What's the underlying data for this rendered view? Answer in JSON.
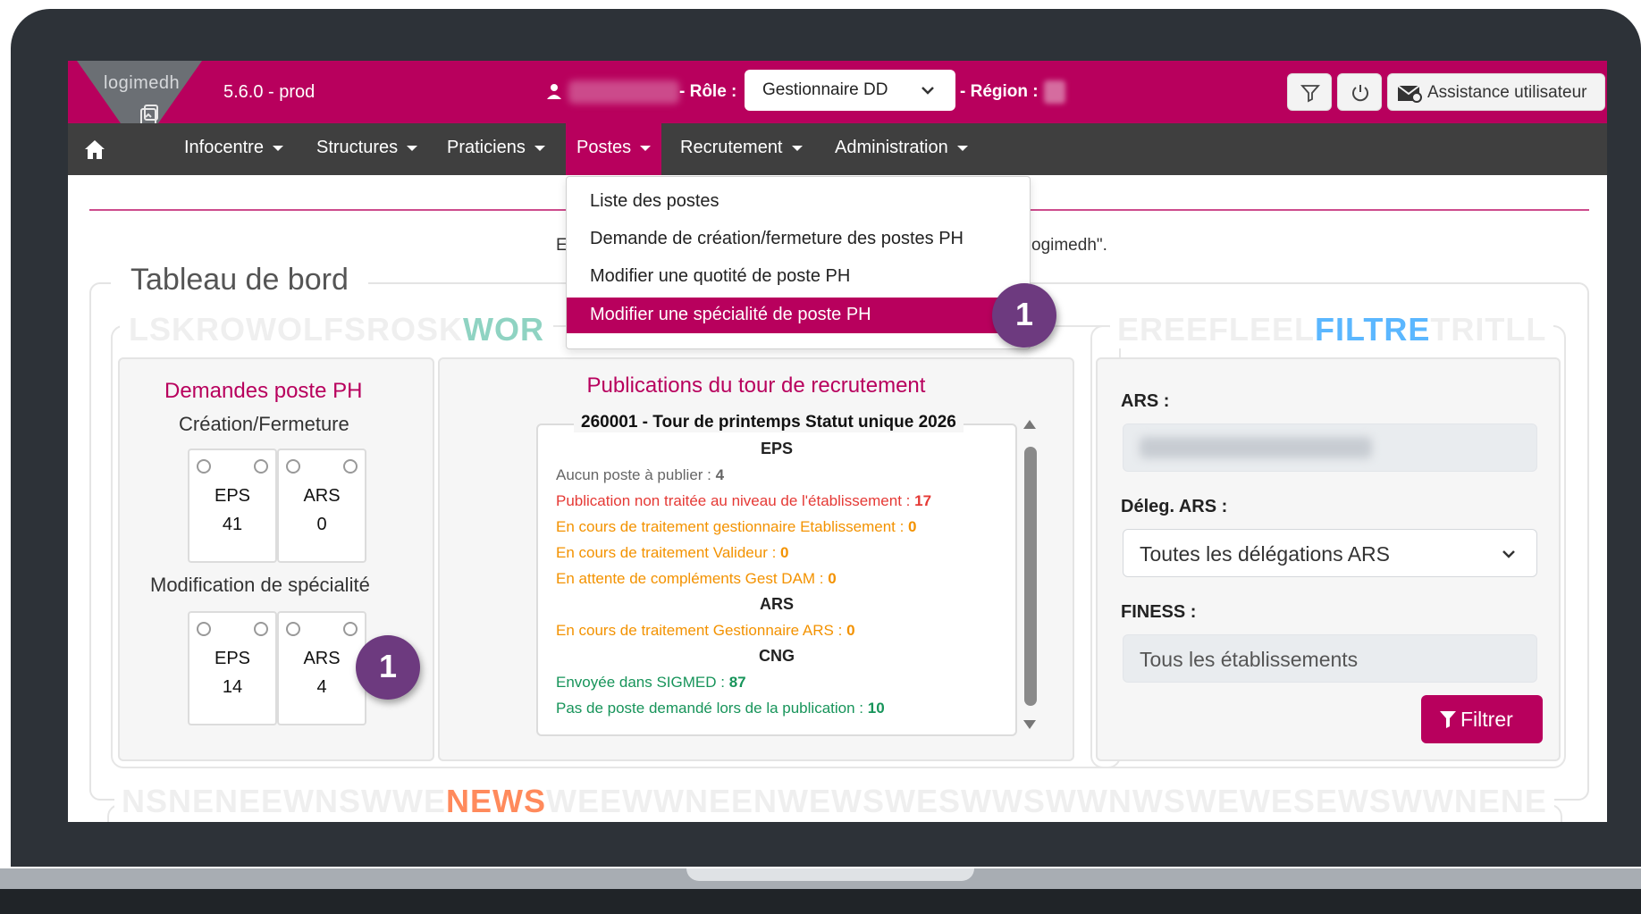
{
  "app": {
    "logo_text": "logimedh",
    "version": "5.6.0 - prod",
    "role_label": "- Rôle :",
    "role_value": "Gestionnaire DD",
    "region_label": "- Région :",
    "assistance_label": "Assistance utilisateur",
    "accent_color": "#b8005d",
    "nav_bg": "#3f3f3f"
  },
  "nav": {
    "items": [
      {
        "label": "Infocentre"
      },
      {
        "label": "Structures"
      },
      {
        "label": "Praticiens"
      },
      {
        "label": "Postes"
      },
      {
        "label": "Recrutement"
      },
      {
        "label": "Administration"
      }
    ]
  },
  "dropdown": {
    "items": [
      {
        "label": "Liste des postes"
      },
      {
        "label": "Demande de création/fermeture des postes PH"
      },
      {
        "label": "Modifier une quotité de poste PH"
      },
      {
        "label": "Modifier une spécialité de poste PH"
      }
    ]
  },
  "welcome": {
    "start": "E",
    "end": "ogimedh\"."
  },
  "dashboard": {
    "title": "Tableau de bord",
    "watermark_1a": "LSKROWOLFSROSK",
    "watermark_1b": "WOR",
    "watermark_2a": "EREEFLEEL",
    "watermark_2b": "FILTRE",
    "watermark_2c": "TRITLL",
    "watermark_3a": "NSNENEEWNSWWE",
    "watermark_3b": "NEWS",
    "watermark_3c": "WEEWWNEENWEWSWESWWSWWNWSWEWESEWSWWNENE"
  },
  "demandes": {
    "title": "Demandes poste PH",
    "creation_title": "Création/Fermeture",
    "creation_cards": [
      {
        "label": "EPS",
        "value": "41"
      },
      {
        "label": "ARS",
        "value": "0"
      }
    ],
    "modif_title": "Modification de spécialité",
    "modif_cards": [
      {
        "label": "EPS",
        "value": "14"
      },
      {
        "label": "ARS",
        "value": "4"
      }
    ]
  },
  "publications": {
    "title": "Publications du tour de recrutement",
    "box_title": "260001 - Tour de printemps Statut unique 2026",
    "eps": "EPS",
    "ars": "ARS",
    "cng": "CNG",
    "lines": [
      {
        "label": "Aucun poste à publier : ",
        "value": "4"
      },
      {
        "label": "Publication non traitée au niveau de l'établissement : ",
        "value": "17"
      },
      {
        "label": "En cours de traitement gestionnaire Etablissement : ",
        "value": "0"
      },
      {
        "label": "En cours de traitement Valideur : ",
        "value": "0"
      },
      {
        "label": "En attente de compléments Gest DAM : ",
        "value": "0"
      },
      {
        "label": "En cours de traitement Gestionnaire ARS : ",
        "value": "0"
      },
      {
        "label": "Envoyée dans SIGMED : ",
        "value": "87"
      },
      {
        "label": "Pas de poste demandé lors de la publication : ",
        "value": "10"
      }
    ]
  },
  "filters": {
    "ars_label": "ARS :",
    "deleg_label": "Déleg. ARS :",
    "deleg_value": "Toutes les délégations ARS",
    "finess_label": "FINESS :",
    "finess_value": "Tous les établissements",
    "filter_button": "Filtrer"
  },
  "badges": {
    "dropdown_badge": "1",
    "card_badge": "1"
  }
}
